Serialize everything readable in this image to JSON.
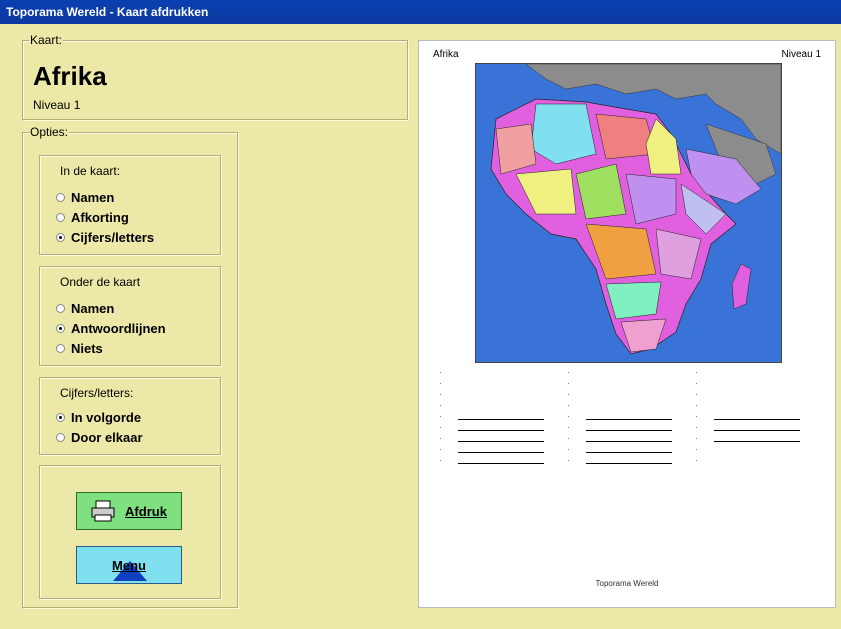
{
  "window": {
    "title": "Toporama Wereld - Kaart afdrukken"
  },
  "kaart": {
    "legend": "Kaart:",
    "name": "Afrika",
    "level": "Niveau 1"
  },
  "opties": {
    "legend": "Opties:",
    "in_de_kaart": {
      "title": "In de kaart:",
      "options": [
        "Namen",
        "Afkorting",
        "Cijfers/letters"
      ],
      "selected": 2
    },
    "onder_de_kaart": {
      "title": "Onder de kaart",
      "options": [
        "Namen",
        "Antwoordlijnen",
        "Niets"
      ],
      "selected": 1
    },
    "cijfers_letters": {
      "title": "Cijfers/letters:",
      "options": [
        "In volgorde",
        "Door elkaar"
      ],
      "selected": 0
    }
  },
  "buttons": {
    "afdruk": "Afdruk",
    "menu": "Menu"
  },
  "preview": {
    "title_left": "Afrika",
    "title_right": "Niveau 1",
    "footer": "Toporama Wereld",
    "answer_rows": 9
  },
  "colors": {
    "window_bg": "#ece9a8",
    "titlebar": "#0a3fb0",
    "afdruk_btn": "#7fe07f",
    "menu_btn": "#7fe0f0",
    "sea": "#3a73d8"
  }
}
